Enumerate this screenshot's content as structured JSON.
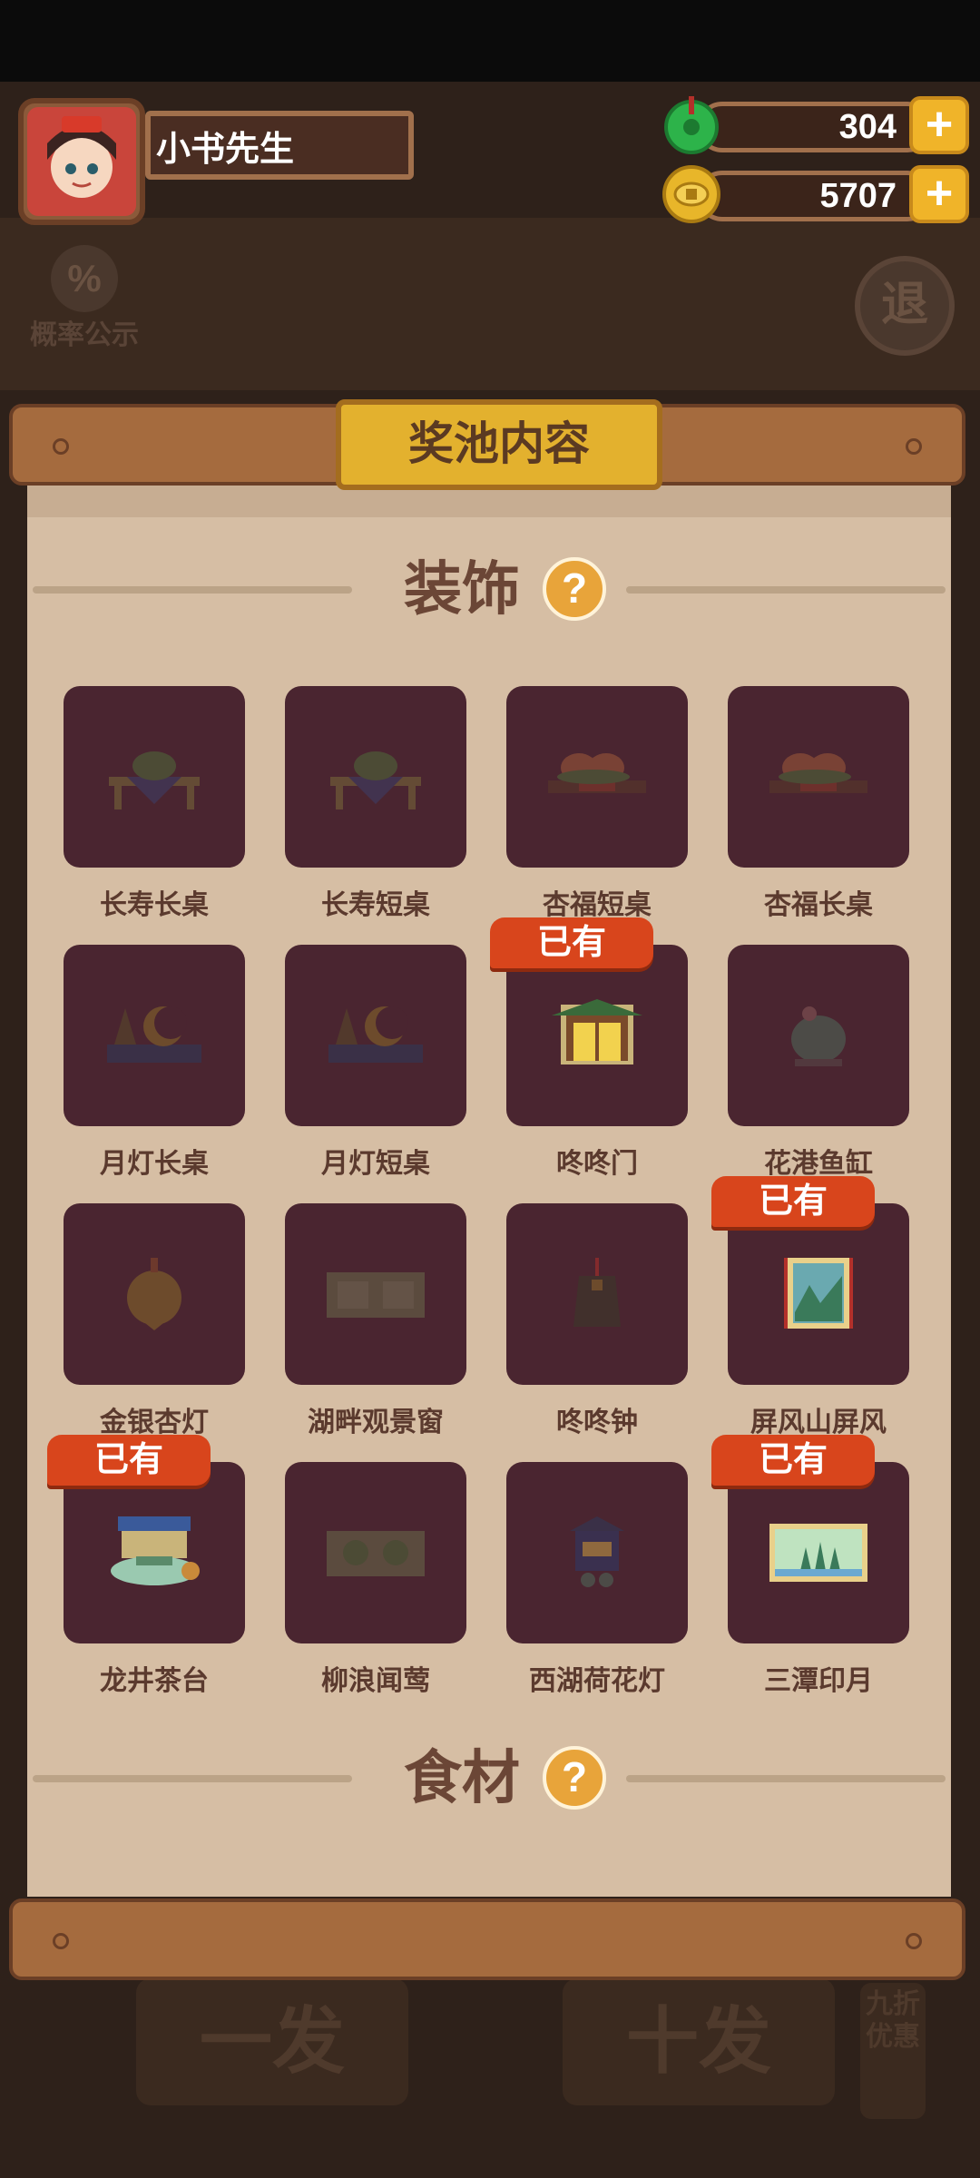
{
  "player": {
    "name": "小书先生"
  },
  "currencies": [
    {
      "icon": "jade-icon",
      "value": "304",
      "color": "#2db34a"
    },
    {
      "icon": "gold-coin-icon",
      "value": "5707",
      "color": "#e8b62a"
    }
  ],
  "background": {
    "probability_label": "概率公示",
    "probability_symbol": "%",
    "exit_label": "退",
    "single_draw": "一发",
    "ten_draw": "十发",
    "discount": "九折优惠"
  },
  "panel": {
    "title": "奖池内容"
  },
  "sections": [
    {
      "label": "装饰",
      "help": "?"
    },
    {
      "label": "食材",
      "help": "?"
    }
  ],
  "owned_badge": "已有",
  "items": [
    {
      "name": "长寿长桌",
      "owned": false
    },
    {
      "name": "长寿短桌",
      "owned": false
    },
    {
      "name": "杏福短桌",
      "owned": false
    },
    {
      "name": "杏福长桌",
      "owned": false
    },
    {
      "name": "月灯长桌",
      "owned": false
    },
    {
      "name": "月灯短桌",
      "owned": false
    },
    {
      "name": "咚咚门",
      "owned": true
    },
    {
      "name": "花港鱼缸",
      "owned": false
    },
    {
      "name": "金银杏灯",
      "owned": false
    },
    {
      "name": "湖畔观景窗",
      "owned": false
    },
    {
      "name": "咚咚钟",
      "owned": false
    },
    {
      "name": "屏风山屏风",
      "owned": true
    },
    {
      "name": "龙井茶台",
      "owned": true
    },
    {
      "name": "柳浪闻莺",
      "owned": false
    },
    {
      "name": "西湖荷花灯",
      "owned": false
    },
    {
      "name": "三潭印月",
      "owned": true
    }
  ]
}
